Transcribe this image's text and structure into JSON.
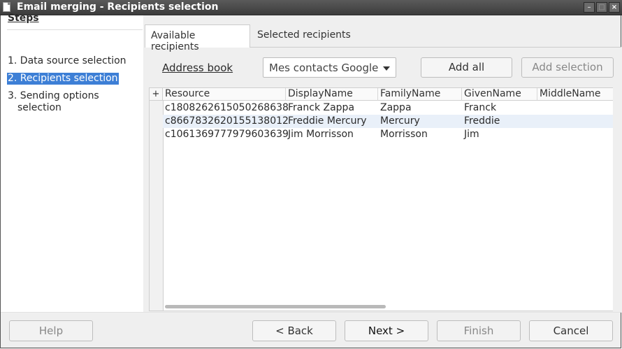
{
  "window": {
    "title": "Email merging - Recipients selection"
  },
  "steps": {
    "title": "Steps",
    "items": [
      {
        "label": "1. Data source selection"
      },
      {
        "label": "2. Recipients selection"
      },
      {
        "label": "3. Sending options",
        "label2": "selection"
      }
    ]
  },
  "tabs": [
    {
      "label": "Available recipients"
    },
    {
      "label": "Selected recipients"
    }
  ],
  "address_book": {
    "label": "Address book",
    "selected": "Mes contacts Google"
  },
  "buttons": {
    "add_all": "Add all",
    "add_selection": "Add selection",
    "help": "Help",
    "back": "< Back",
    "next": "Next >",
    "finish": "Finish",
    "cancel": "Cancel"
  },
  "table": {
    "expand": "+",
    "columns": [
      "Resource",
      "DisplayName",
      "FamilyName",
      "GivenName",
      "MiddleName"
    ],
    "rows": [
      [
        "c1808262615050268638",
        "Franck Zappa",
        "Zappa",
        "Franck",
        ""
      ],
      [
        "c8667832620155138012",
        "Freddie Mercury",
        "Mercury",
        "Freddie",
        ""
      ],
      [
        "c1061369777979603639",
        "Jim Morrisson",
        "Morrisson",
        "Jim",
        ""
      ]
    ]
  }
}
